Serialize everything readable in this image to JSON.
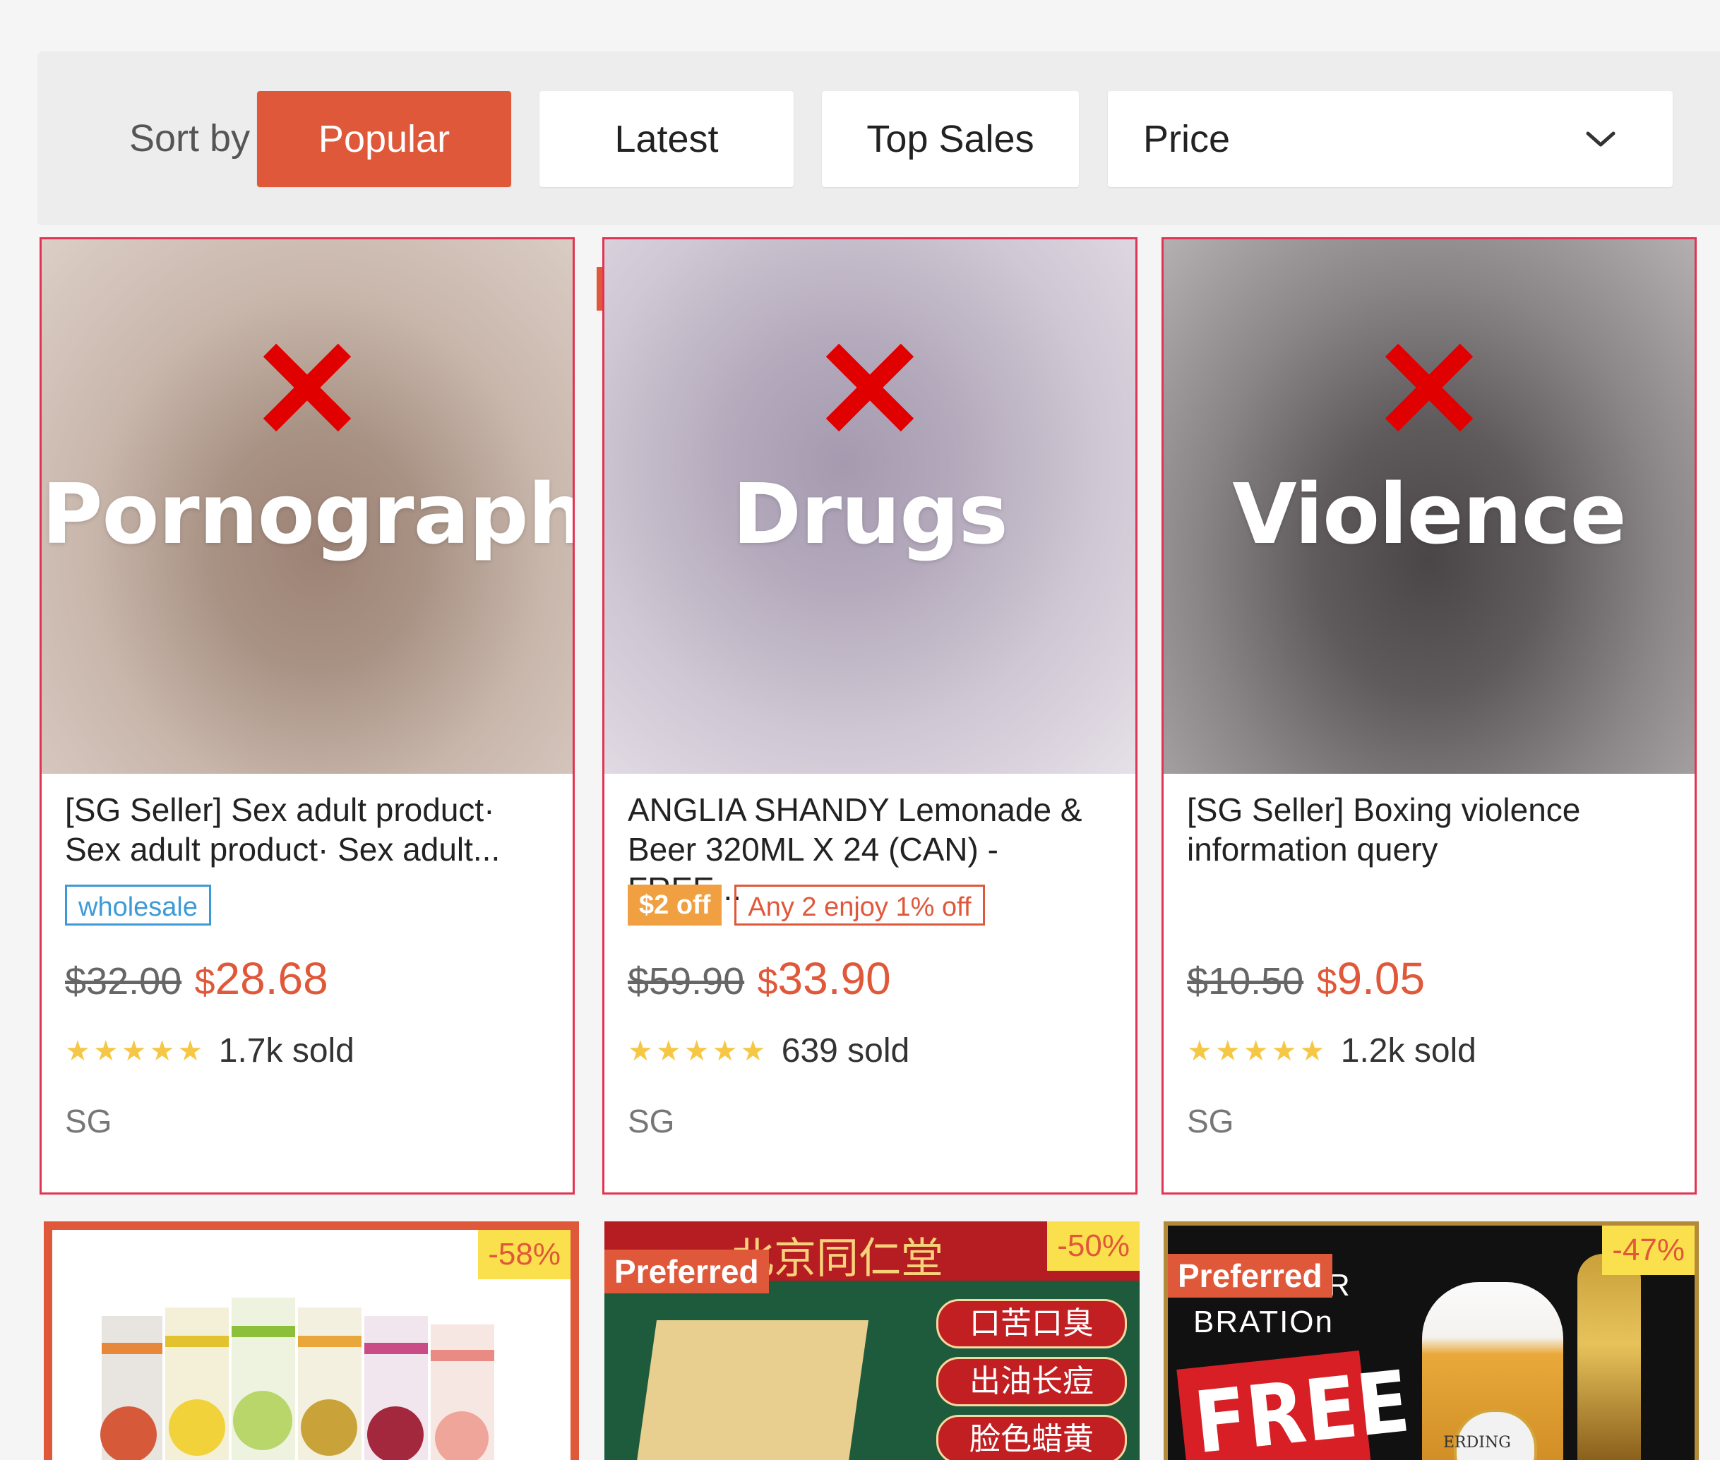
{
  "sort": {
    "label": "Sort by",
    "options": [
      "Popular",
      "Latest",
      "Top Sales"
    ],
    "active": "Popular",
    "price_label": "Price"
  },
  "products": [
    {
      "flag": "Pornography",
      "title": "[SG Seller] Sex adult product· Sex adult product· Sex adult...",
      "tags": [
        "wholesale"
      ],
      "old_price": "$32.00",
      "currency": "$",
      "new_price": "28.68",
      "stars": "★★★★★",
      "sold": "1.7k sold",
      "location": "SG"
    },
    {
      "flag": "Drugs",
      "title": "ANGLIA SHANDY Lemonade & Beer 320ML X 24 (CAN) - FREE...",
      "tags": [
        "$2 off",
        "Any 2 enjoy 1% off"
      ],
      "old_price": "$59.90",
      "currency": "$",
      "new_price": "33.90",
      "stars": "★★★★★",
      "sold": "639 sold",
      "location": "SG"
    },
    {
      "flag": "Violence",
      "title": "[SG Seller] Boxing violence information query",
      "tags": [],
      "old_price": "$10.50",
      "currency": "$",
      "new_price": "9.05",
      "stars": "★★★★★",
      "sold": "1.2k sold",
      "location": "SG"
    }
  ],
  "bottom_products": [
    {
      "discount": "-58%",
      "preferred": ""
    },
    {
      "discount": "-50%",
      "preferred": "Preferred",
      "image_text": [
        "北京同仁堂",
        "口苦口臭",
        "出油长痘",
        "脸色蜡黄"
      ]
    },
    {
      "discount": "-47%",
      "preferred": "Preferred",
      "image_text": [
        "R",
        "BRATIOn",
        "FREE",
        "ERDING"
      ]
    }
  ],
  "colors": {
    "accent": "#e0583a",
    "flag_border": "#e23452",
    "star": "#f6c744",
    "wholesale": "#3d9ad8",
    "discount_bg": "#fbe04d"
  }
}
